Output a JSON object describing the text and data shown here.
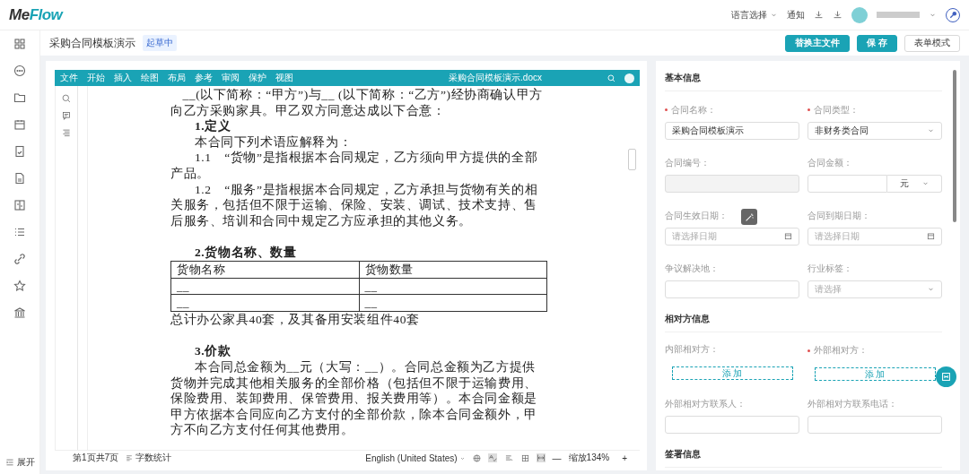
{
  "header": {
    "logo_dark": "Me",
    "logo_accent": "Flow",
    "language": "语言选择",
    "notify": "通知"
  },
  "sidebar": {
    "expand": "展开"
  },
  "page": {
    "title": "采购合同模板演示",
    "status": "起草中",
    "buttons": [
      {
        "label": "替换主文件",
        "kind": "primary"
      },
      {
        "label": "保 存",
        "kind": "primary"
      },
      {
        "label": "表单模式",
        "kind": "default"
      }
    ]
  },
  "editor": {
    "menu": [
      "文件",
      "开始",
      "插入",
      "绘图",
      "布局",
      "参考",
      "审阅",
      "保护",
      "视图"
    ],
    "file_name": "采购合同模板演示.docx",
    "document": [
      {
        "kind": "continued",
        "text": "__(以下简称：“甲方”)与__ (以下简称：“乙方”)经协商确认甲方向乙方采购家具。甲乙双方同意达成以下合意："
      },
      {
        "kind": "heading",
        "text": "1.定义"
      },
      {
        "kind": "body",
        "text": "本合同下列术语应解释为："
      },
      {
        "kind": "body",
        "text": "1.1　“货物”是指根据本合同规定，乙方须向甲方提供的全部产品。"
      },
      {
        "kind": "body",
        "text": "1.2　“服务”是指根据本合同规定，乙方承担与货物有关的相关服务，包括但不限于运输、保险、安装、调试、技术支持、售后服务、培训和合同中规定乙方应承担的其他义务。"
      },
      {
        "kind": "heading",
        "text": "2.货物名称、数量",
        "space_before": true
      },
      {
        "kind": "table",
        "header": [
          "货物名称",
          "货物数量"
        ],
        "rows": [
          [
            "__",
            "__"
          ],
          [
            "__",
            "__"
          ]
        ]
      },
      {
        "kind": "plain",
        "text": "总计办公家具40套，及其备用安装组件40套"
      },
      {
        "kind": "heading",
        "text": "3.价款",
        "space_before": true
      },
      {
        "kind": "body",
        "text": "本合同总金额为__元（大写：__）。合同总金额为乙方提供货物并完成其他相关服务的全部价格（包括但不限于运输费用、保险费用、装卸费用、保管费用、报关费用等）。本合同金额是甲方依据本合同应向乙方支付的全部价款，除本合同金额外，甲方不向乙方支付任何其他费用。"
      }
    ],
    "status_bar": {
      "page": "第1页共7页",
      "word_count": "字数统计",
      "language": "English (United States)",
      "zoom_out": "—",
      "zoom": "缩放134%",
      "zoom_in": "+"
    }
  },
  "form": {
    "sections": [
      {
        "title": "基本信息",
        "fields": [
          {
            "label": "合同名称：",
            "required": true,
            "kind": "text",
            "value": "采购合同模板演示"
          },
          {
            "label": "合同类型：",
            "required": true,
            "kind": "select",
            "value": "非财务类合同"
          },
          {
            "label": "合同编号：",
            "required": false,
            "kind": "disabled"
          },
          {
            "label": "合同金额：",
            "required": false,
            "kind": "amount",
            "unit": "元"
          },
          {
            "label": "合同生效日期：",
            "required": false,
            "kind": "date",
            "placeholder": "请选择日期"
          },
          {
            "label": "合同到期日期：",
            "required": false,
            "kind": "date",
            "placeholder": "请选择日期"
          },
          {
            "label": "争议解决地：",
            "required": false,
            "kind": "text"
          },
          {
            "label": "行业标签：",
            "required": false,
            "kind": "select",
            "placeholder": "请选择"
          }
        ]
      },
      {
        "title": "相对方信息",
        "fields": [
          {
            "label": "内部相对方：",
            "required": false,
            "kind": "add",
            "button": "添 加"
          },
          {
            "label": "外部相对方：",
            "required": true,
            "kind": "add",
            "button": "添 加"
          },
          {
            "label": "外部相对方联系人：",
            "required": false,
            "kind": "text"
          },
          {
            "label": "外部相对方联系电话：",
            "required": false,
            "kind": "text"
          }
        ]
      },
      {
        "title": "签署信息"
      }
    ]
  }
}
